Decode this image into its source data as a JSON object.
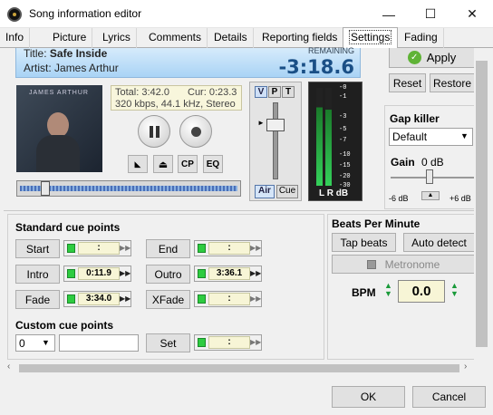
{
  "window": {
    "title": "Song information editor",
    "min": "—",
    "max": "☐",
    "close": "✕"
  },
  "tabs": [
    {
      "label": "Info"
    },
    {
      "label": "Picture"
    },
    {
      "label": "Lyrics"
    },
    {
      "label": "Comments"
    },
    {
      "label": "Details"
    },
    {
      "label": "Reporting fields"
    },
    {
      "label": "Settings"
    },
    {
      "label": "Fading"
    }
  ],
  "player": {
    "title_label": "Title:",
    "title": "Safe Inside",
    "artist_label": "Artist:",
    "artist": "James Arthur",
    "remaining_label": "REMAINING",
    "remaining": "-3:18.6",
    "total": "Total: 3:42.0",
    "cur": "Cur: 0:23.3",
    "format": "320 kbps, 44.1 kHz, Stereo",
    "album_art_text": "JAMES ARTHUR",
    "btn_cp": "CP",
    "btn_eq": "EQ",
    "vpt": [
      "V",
      "P",
      "T"
    ],
    "air": "Air",
    "cue": "Cue",
    "lr_db": "L R dB",
    "db_ticks": [
      "-0",
      "-1",
      "-3",
      "-5",
      "-7",
      "-10",
      "-15",
      "-20",
      "-30"
    ]
  },
  "apply": {
    "apply": "Apply",
    "reset": "Reset",
    "restore": "Restore"
  },
  "gap_killer": {
    "title": "Gap killer",
    "selected": "Default",
    "gain_label": "Gain",
    "gain_value": "0 dB",
    "min": "-6 dB",
    "max": "+6 dB"
  },
  "cue_points": {
    "title": "Standard cue points",
    "start": {
      "label": "Start",
      "value": ":"
    },
    "end": {
      "label": "End",
      "value": ":"
    },
    "intro": {
      "label": "Intro",
      "value": "0:11.9"
    },
    "outro": {
      "label": "Outro",
      "value": "3:36.1"
    },
    "fade": {
      "label": "Fade",
      "value": "3:34.0"
    },
    "xfade": {
      "label": "XFade",
      "value": ":"
    },
    "custom_title": "Custom cue points",
    "custom_index": "0",
    "custom_name": "",
    "set": "Set",
    "set_value": ":"
  },
  "bpm": {
    "title": "Beats Per Minute",
    "tap": "Tap beats",
    "auto": "Auto detect",
    "metronome": "Metronome",
    "label": "BPM",
    "value": "0.0"
  },
  "footer": {
    "ok": "OK",
    "cancel": "Cancel"
  }
}
